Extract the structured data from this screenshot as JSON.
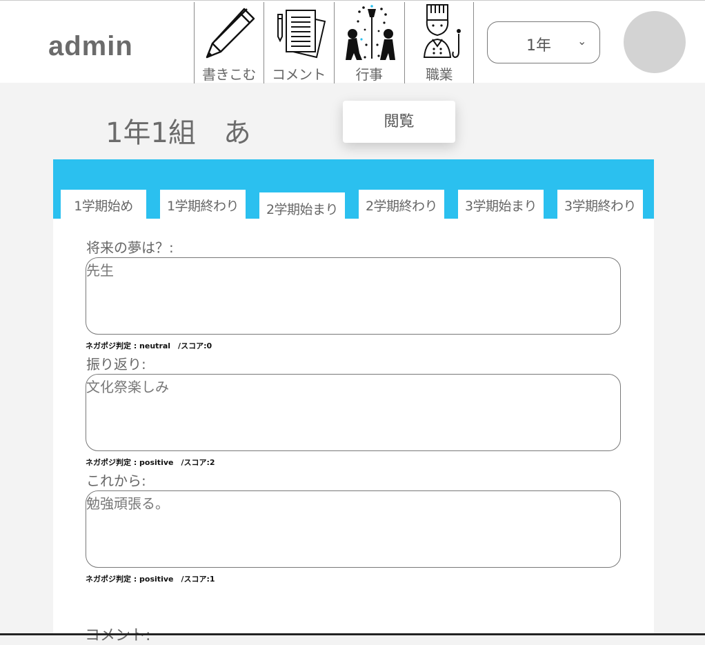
{
  "header": {
    "brand": "admin",
    "nav": [
      {
        "label": "書きこむ",
        "icon": "pencil-icon"
      },
      {
        "label": "コメント",
        "icon": "document-pen-icon"
      },
      {
        "label": "行事",
        "icon": "festival-icon"
      },
      {
        "label": "職業",
        "icon": "chef-icon"
      }
    ],
    "grade_select": {
      "value": "1年",
      "chevron": "chevron-down-icon"
    },
    "avatar": "user-avatar"
  },
  "dropdown": {
    "view_label": "閲覧"
  },
  "page": {
    "title": "1年1組　あ"
  },
  "tabs": [
    {
      "label": "1学期始め"
    },
    {
      "label": "1学期終わり"
    },
    {
      "label": "2学期始まり",
      "active": true
    },
    {
      "label": "2学期終わり"
    },
    {
      "label": "3学期始まり"
    },
    {
      "label": "3学期終わり"
    }
  ],
  "questions": [
    {
      "label": "将来の夢は？:",
      "answer": "先生",
      "sentiment": "ネガポジ判定 : neutral　/スコア:0"
    },
    {
      "label": "振り返り:",
      "answer": "文化祭楽しみ",
      "sentiment": "ネガポジ判定 : positive　/スコア:2"
    },
    {
      "label": "これから:",
      "answer": "勉強頑張る。",
      "sentiment": "ネガポジ判定 : positive　/スコア:1"
    }
  ],
  "comment": {
    "label": "コメント:"
  },
  "colors": {
    "accent": "#2bc0ef",
    "background": "#f3f3f3",
    "avatar": "#d3d3d3"
  }
}
